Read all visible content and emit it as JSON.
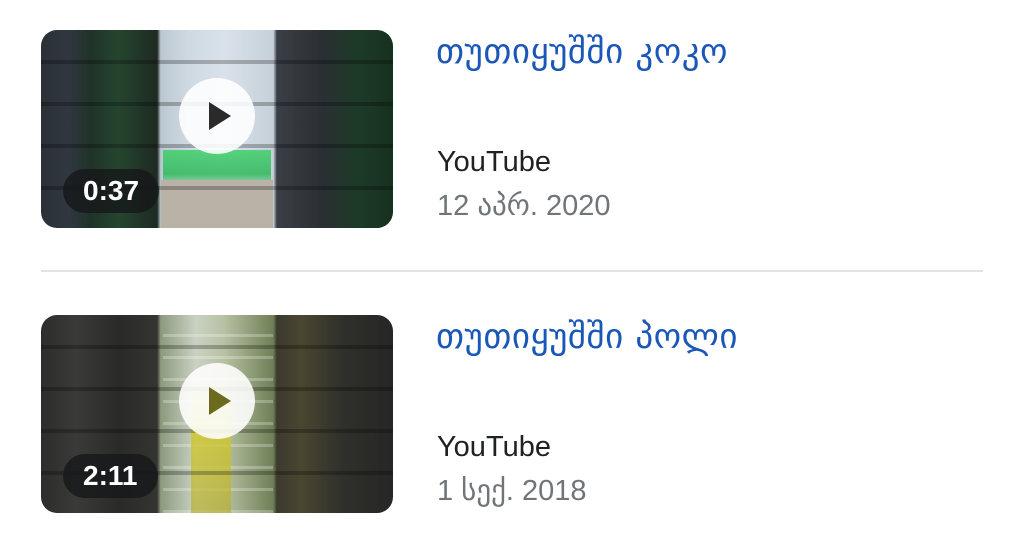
{
  "results": [
    {
      "title": "თუთიყუშში კოკო",
      "source": "YouTube",
      "date": "12 აპრ. 2020",
      "duration": "0:37",
      "play_icon": "play-icon"
    },
    {
      "title": "თუთიყუშში პოლი",
      "source": "YouTube",
      "date": "1 სექ. 2018",
      "duration": "2:11",
      "play_icon": "play-icon"
    }
  ],
  "colors": {
    "title": "#1a57b8",
    "source": "#202124",
    "date": "#70757a",
    "divider": "#e3e3e3"
  }
}
